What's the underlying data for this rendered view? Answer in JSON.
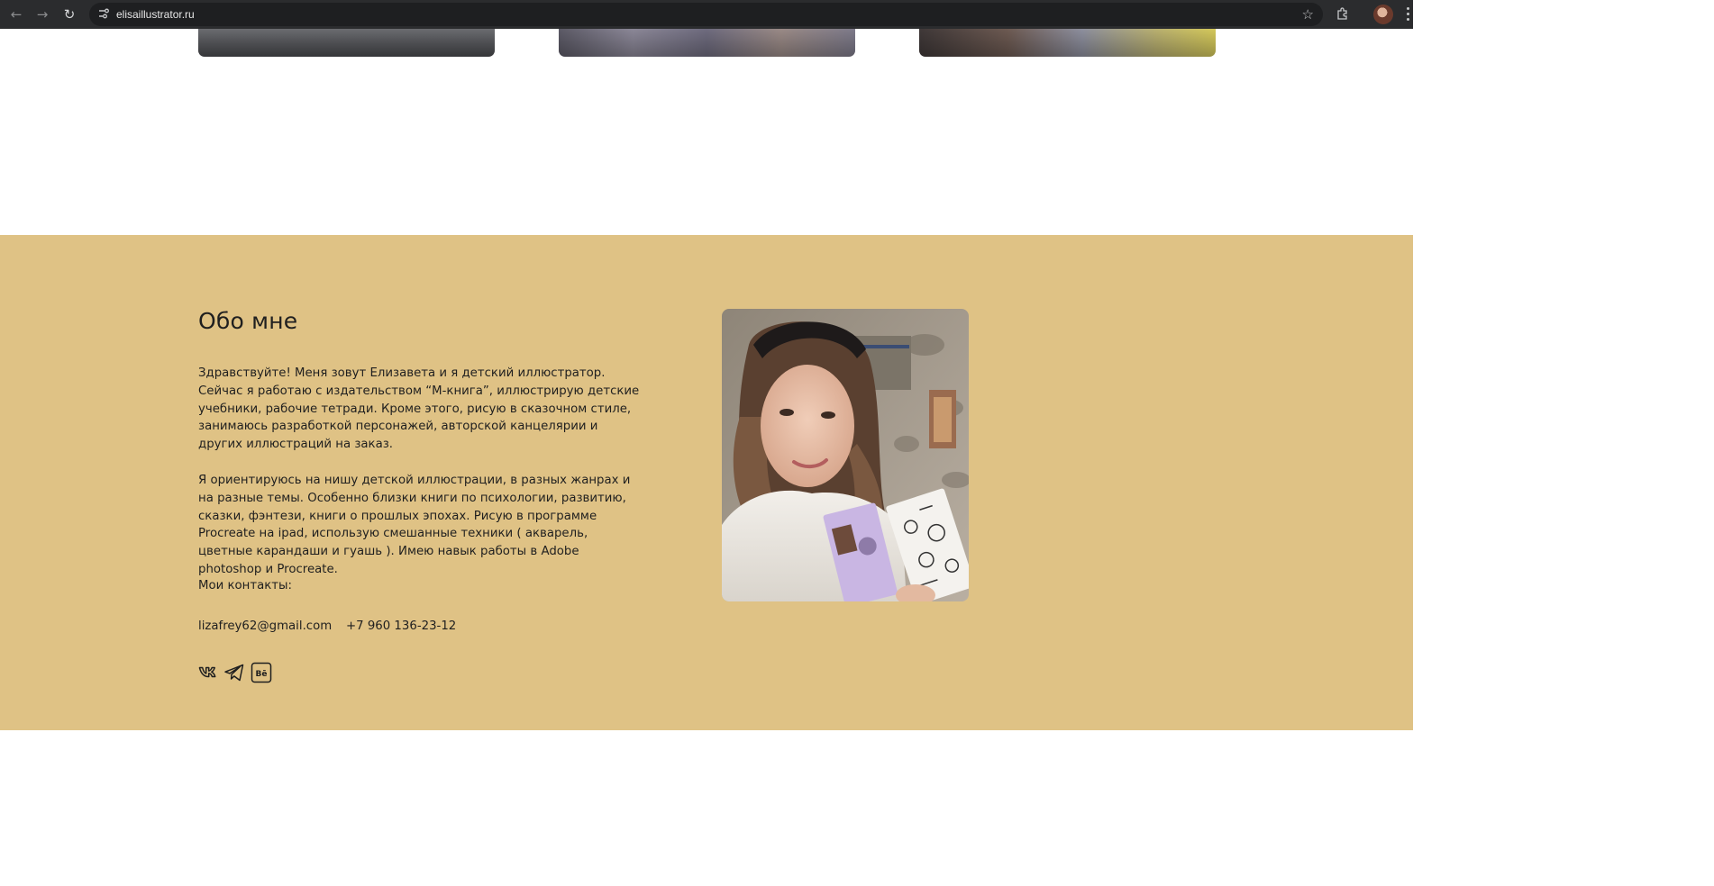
{
  "browser": {
    "url": "elisaillustrator.ru",
    "back_icon": "arrow-left-icon",
    "forward_icon": "arrow-right-icon",
    "reload_icon": "reload-icon"
  },
  "gallery": {
    "thumbnails": [
      "illustration-1",
      "illustration-2",
      "illustration-3"
    ]
  },
  "about": {
    "title": "Обо мне",
    "paragraph1": "Здравствуйте! Меня зовут Елизавета и я детский иллюстратор. Сейчас я работаю с издательством “М-книга”, иллюстрирую детские учебники, рабочие тетради. Кроме этого, рисую в сказочном стиле, занимаюсь разработкой персонажей, авторской канцелярии и других иллюстраций на заказ.",
    "paragraph2": "Я ориентируюсь на нишу детской иллюстрации, в разных жанрах и на разные темы. Особенно близки книги по психологии, развитию, сказки, фэнтези, книги о прошлых эпохах. Рисую в программе Procreate на ipad, использую смешанные техники ( акварель, цветные карандаши и гуашь ). Имею навык работы в Adobe photoshop и Procreate.",
    "contacts_label": "Мои контакты:",
    "email": "lizafrey62@gmail.com",
    "phone": "+7 960 136-23-12",
    "socials": [
      "vk-icon",
      "telegram-icon",
      "behance-icon"
    ],
    "behance_glyph": "Bē",
    "background_color": "#dfc285"
  }
}
